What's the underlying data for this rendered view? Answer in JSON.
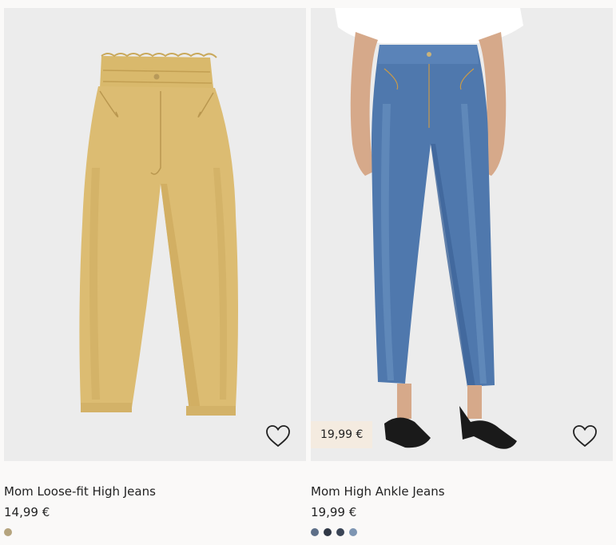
{
  "products": [
    {
      "title": "Mom Loose-fit High Jeans",
      "price": "14,99 €",
      "swatches": [
        "#b5a47e"
      ],
      "image_icon": "yellow-paperbag-jeans"
    },
    {
      "title": "Mom High Ankle Jeans",
      "price": "19,99 €",
      "badge": "19,99 €",
      "swatches": [
        "#5d6f88",
        "#303846",
        "#3a4556",
        "#7d95b2"
      ],
      "image_icon": "blue-mom-jeans-model"
    }
  ],
  "colors": {
    "background": "#faf9f8",
    "image_bg": "#ececec",
    "badge_bg": "#f4ebe0"
  }
}
